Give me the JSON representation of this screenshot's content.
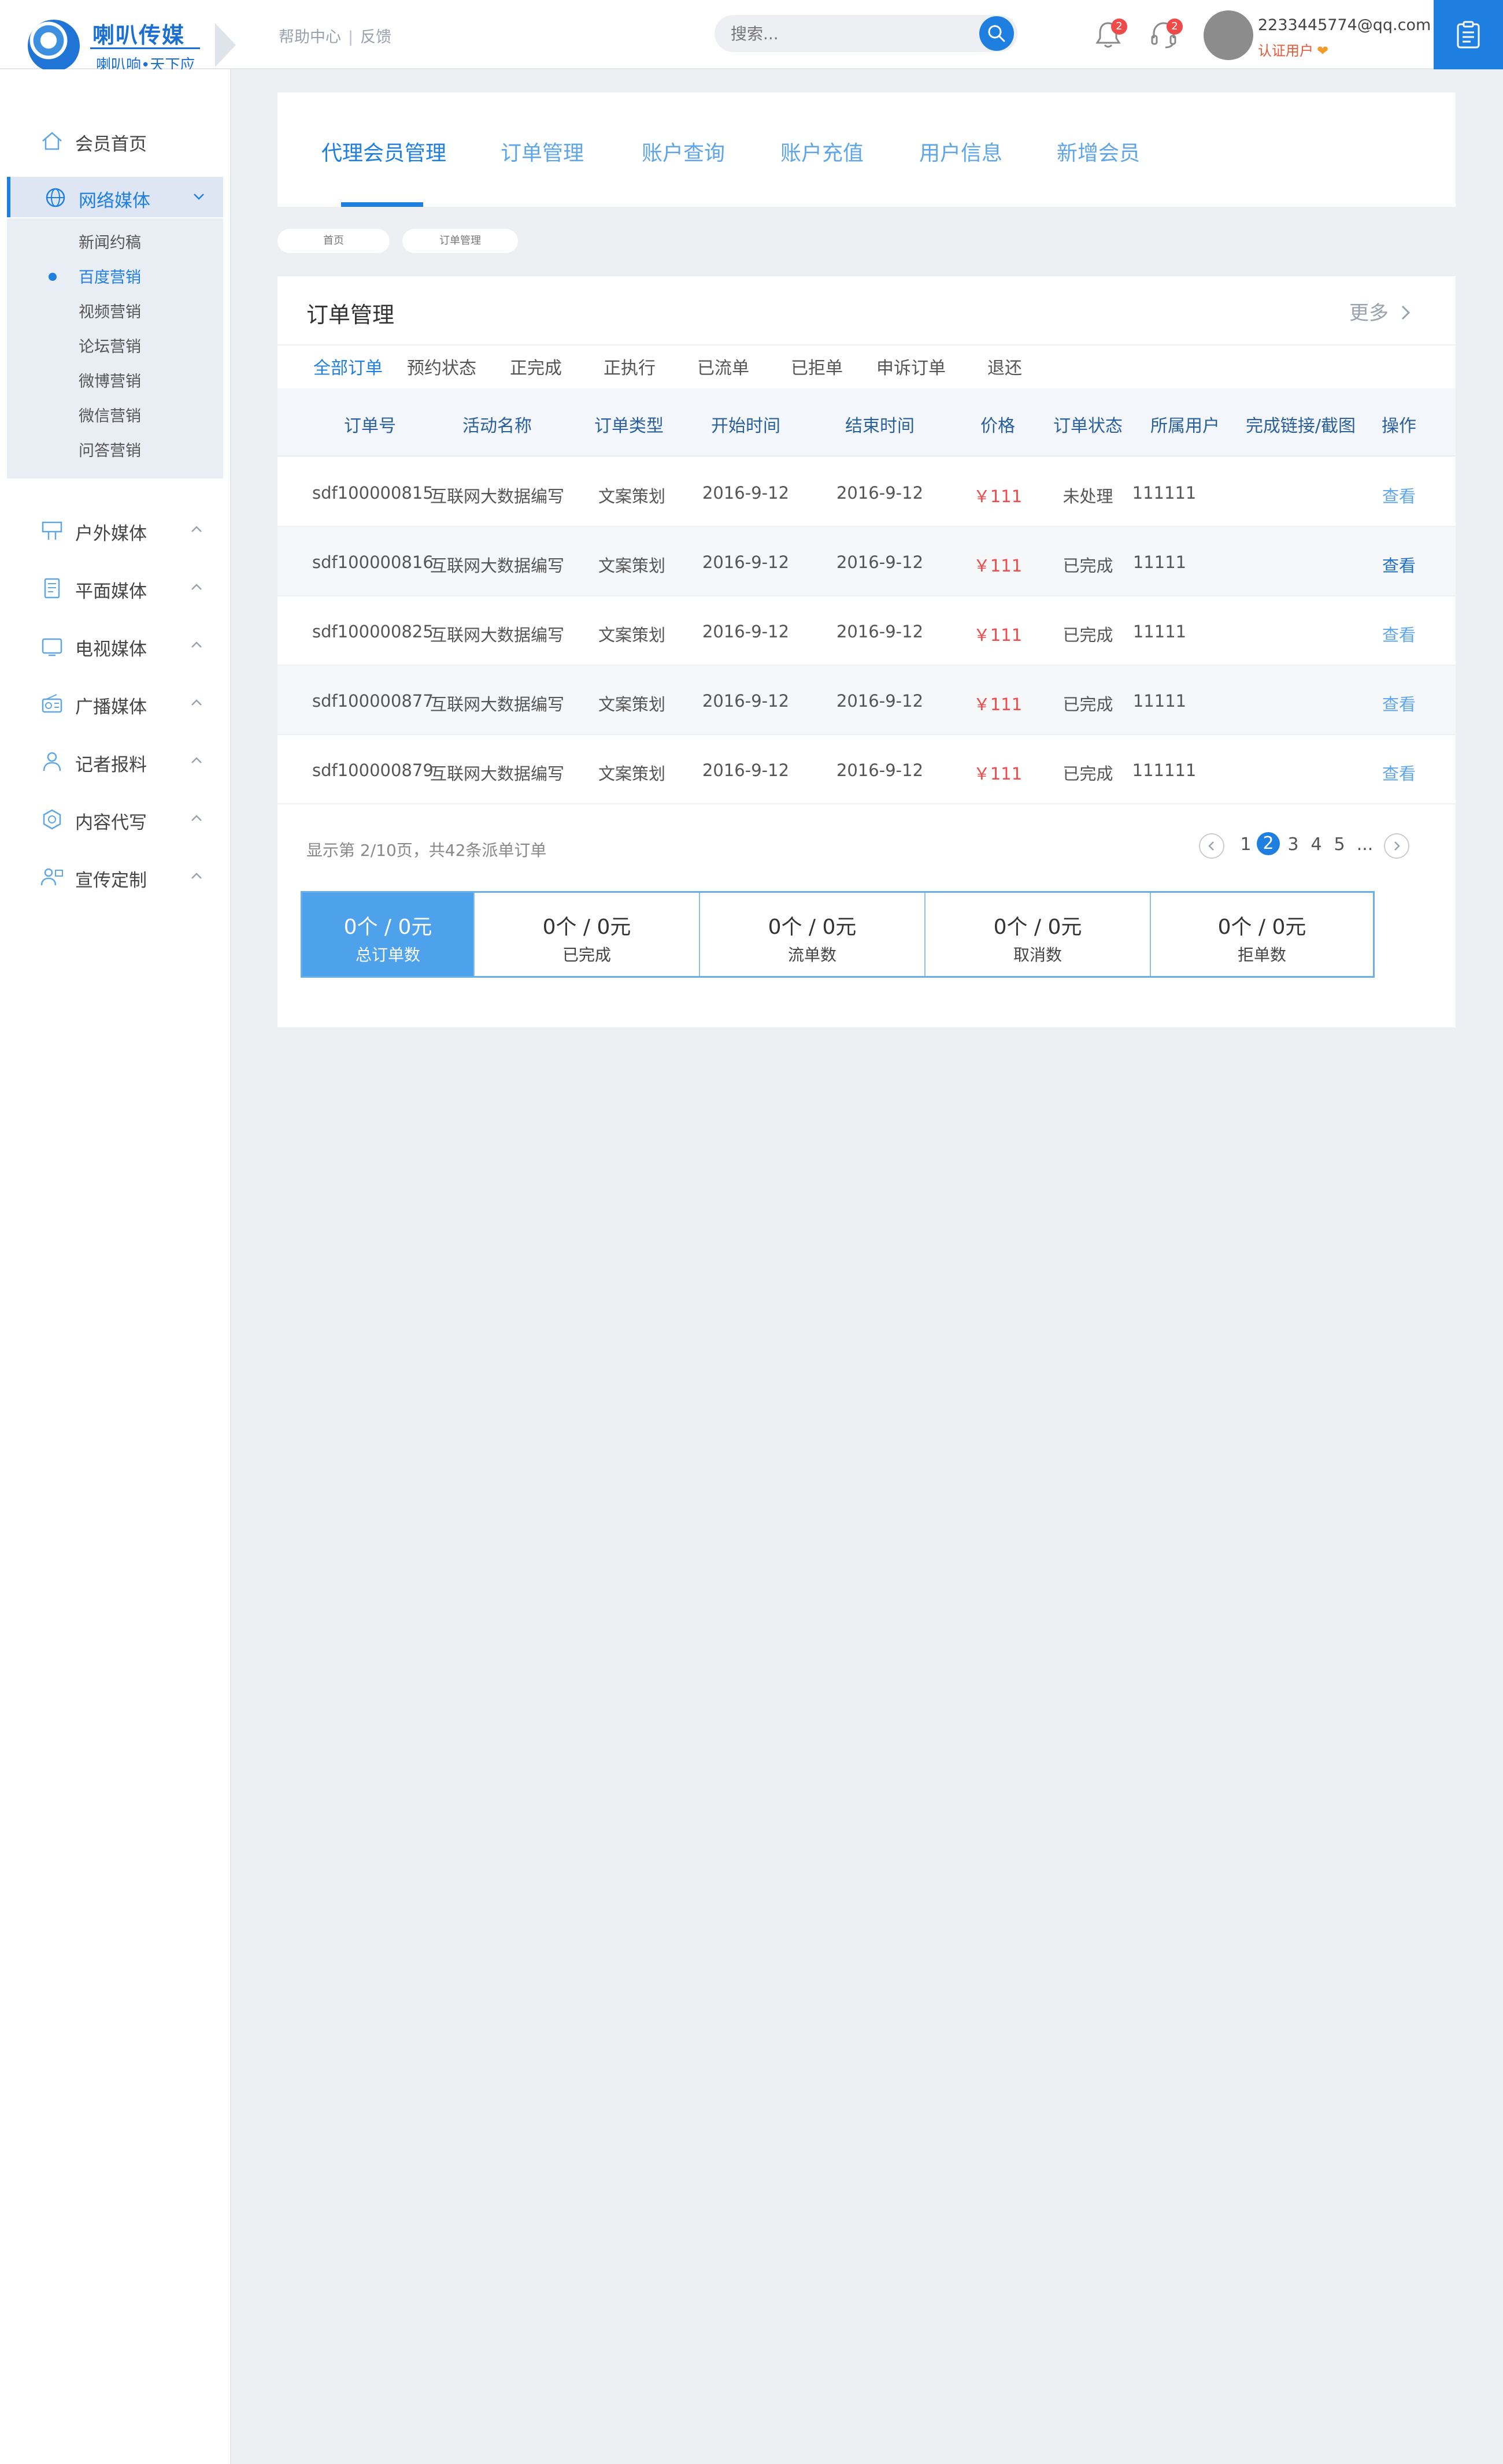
{
  "brand": {
    "name": "喇叭传媒",
    "slogan": "喇叭响•天下应"
  },
  "header": {
    "help": "帮助中心",
    "separator": "|",
    "feedback": "反馈",
    "search_placeholder": "搜索...",
    "bell_count": "2",
    "service_count": "2",
    "user_email": "2233445774@qq.com",
    "user_tag": "认证用户"
  },
  "sidebar": {
    "items": [
      {
        "label": "会员首页"
      },
      {
        "label": "网络媒体"
      },
      {
        "label": "户外媒体"
      },
      {
        "label": "平面媒体"
      },
      {
        "label": "电视媒体"
      },
      {
        "label": "广播媒体"
      },
      {
        "label": "记者报料"
      },
      {
        "label": "内容代写"
      },
      {
        "label": "宣传定制"
      }
    ],
    "submenu": [
      "新闻约稿",
      "百度营销",
      "视频营销",
      "论坛营销",
      "微博营销",
      "微信营销",
      "问答营销"
    ]
  },
  "tabs": [
    "代理会员管理",
    "订单管理",
    "账户查询",
    "账户充值",
    "用户信息",
    "新增会员"
  ],
  "breadcrumb": [
    "首页",
    "订单管理"
  ],
  "orders": {
    "title": "订单管理",
    "more": "更多",
    "filters": [
      "全部订单",
      "预约状态",
      "正完成",
      "正执行",
      "已流单",
      "已拒单",
      "申诉订单",
      "退还"
    ],
    "columns": [
      "订单号",
      "活动名称",
      "订单类型",
      "开始时间",
      "结束时间",
      "价格",
      "订单状态",
      "所属用户",
      "完成链接/截图",
      "操作"
    ],
    "rows": [
      [
        "sdf100000815",
        "互联网大数据编写",
        "文案策划",
        "2016-9-12",
        "2016-9-12",
        "￥111",
        "未处理",
        "111111",
        "",
        "查看"
      ],
      [
        "sdf100000816",
        "互联网大数据编写",
        "文案策划",
        "2016-9-12",
        "2016-9-12",
        "￥111",
        "已完成",
        "11111",
        "",
        "查看"
      ],
      [
        "sdf100000825",
        "互联网大数据编写",
        "文案策划",
        "2016-9-12",
        "2016-9-12",
        "￥111",
        "已完成",
        "11111",
        "",
        "查看"
      ],
      [
        "sdf100000877",
        "互联网大数据编写",
        "文案策划",
        "2016-9-12",
        "2016-9-12",
        "￥111",
        "已完成",
        "11111",
        "",
        "查看"
      ],
      [
        "sdf100000879",
        "互联网大数据编写",
        "文案策划",
        "2016-9-12",
        "2016-9-12",
        "￥111",
        "已完成",
        "111111",
        "",
        "查看"
      ]
    ],
    "page_info": "显示第 2/10页，共42条派单订单",
    "pager": [
      "1",
      "2",
      "3",
      "4",
      "5",
      "..."
    ],
    "stats": [
      {
        "value": "0个 / 0元",
        "label": "总订单数"
      },
      {
        "value": "0个 / 0元",
        "label": "已完成"
      },
      {
        "value": "0个 / 0元",
        "label": "流单数"
      },
      {
        "value": "0个 / 0元",
        "label": "取消数"
      },
      {
        "value": "0个 / 0元",
        "label": "拒单数"
      }
    ]
  },
  "colors": {
    "accent": "#1f7fe0",
    "price": "#f04a4a",
    "link": "#5ea6e8"
  }
}
